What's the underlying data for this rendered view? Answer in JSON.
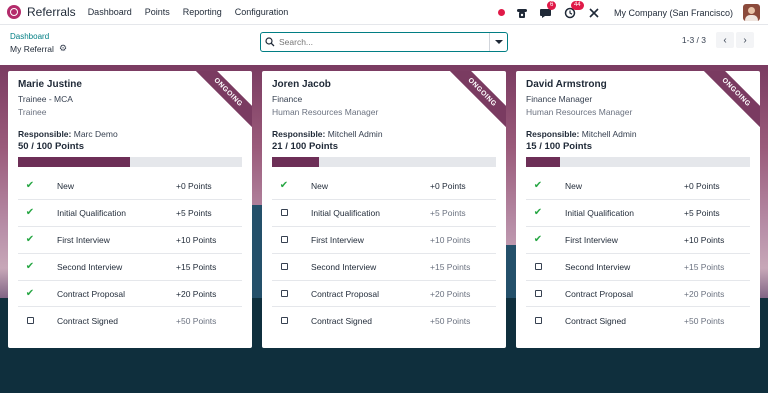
{
  "app": {
    "name": "Referrals"
  },
  "menu": [
    "Dashboard",
    "Points",
    "Reporting",
    "Configuration"
  ],
  "systray": {
    "messages_badge": "6",
    "activities_badge": "44",
    "company": "My Company (San Francisco)"
  },
  "breadcrumb": {
    "parent": "Dashboard",
    "current": "My Referral"
  },
  "search": {
    "placeholder": "Search..."
  },
  "pager": {
    "value": "1-3 / 3"
  },
  "colors": {
    "brand": "#7a3b61",
    "done_check": "#28a745",
    "progress": "#6d2f57",
    "link": "#017e84"
  },
  "cards": [
    {
      "name": "Marie Justine",
      "job": "Trainee - MCA",
      "position": "Trainee",
      "status": "ONGOING",
      "responsible_label": "Responsible:",
      "responsible": "Marc Demo",
      "points_text": "50 / 100 Points",
      "progress_fraction": 0.5,
      "stages": [
        {
          "name": "New",
          "points": "+0 Points",
          "done": true
        },
        {
          "name": "Initial Qualification",
          "points": "+5 Points",
          "done": true
        },
        {
          "name": "First Interview",
          "points": "+10 Points",
          "done": true
        },
        {
          "name": "Second Interview",
          "points": "+15 Points",
          "done": true
        },
        {
          "name": "Contract Proposal",
          "points": "+20 Points",
          "done": true
        },
        {
          "name": "Contract Signed",
          "points": "+50 Points",
          "done": false
        }
      ]
    },
    {
      "name": "Joren Jacob",
      "job": "Finance",
      "position": "Human Resources Manager",
      "status": "ONGOING",
      "responsible_label": "Responsible:",
      "responsible": "Mitchell Admin",
      "points_text": "21 / 100 Points",
      "progress_fraction": 0.21,
      "stages": [
        {
          "name": "New",
          "points": "+0 Points",
          "done": true
        },
        {
          "name": "Initial Qualification",
          "points": "+5 Points",
          "done": false
        },
        {
          "name": "First Interview",
          "points": "+10 Points",
          "done": false
        },
        {
          "name": "Second Interview",
          "points": "+15 Points",
          "done": false
        },
        {
          "name": "Contract Proposal",
          "points": "+20 Points",
          "done": false
        },
        {
          "name": "Contract Signed",
          "points": "+50 Points",
          "done": false
        }
      ]
    },
    {
      "name": "David Armstrong",
      "job": "Finance Manager",
      "position": "Human Resources Manager",
      "status": "ONGOING",
      "responsible_label": "Responsible:",
      "responsible": "Mitchell Admin",
      "points_text": "15 / 100 Points",
      "progress_fraction": 0.15,
      "stages": [
        {
          "name": "New",
          "points": "+0 Points",
          "done": true
        },
        {
          "name": "Initial Qualification",
          "points": "+5 Points",
          "done": true
        },
        {
          "name": "First Interview",
          "points": "+10 Points",
          "done": true
        },
        {
          "name": "Second Interview",
          "points": "+15 Points",
          "done": false
        },
        {
          "name": "Contract Proposal",
          "points": "+20 Points",
          "done": false
        },
        {
          "name": "Contract Signed",
          "points": "+50 Points",
          "done": false
        }
      ]
    }
  ]
}
